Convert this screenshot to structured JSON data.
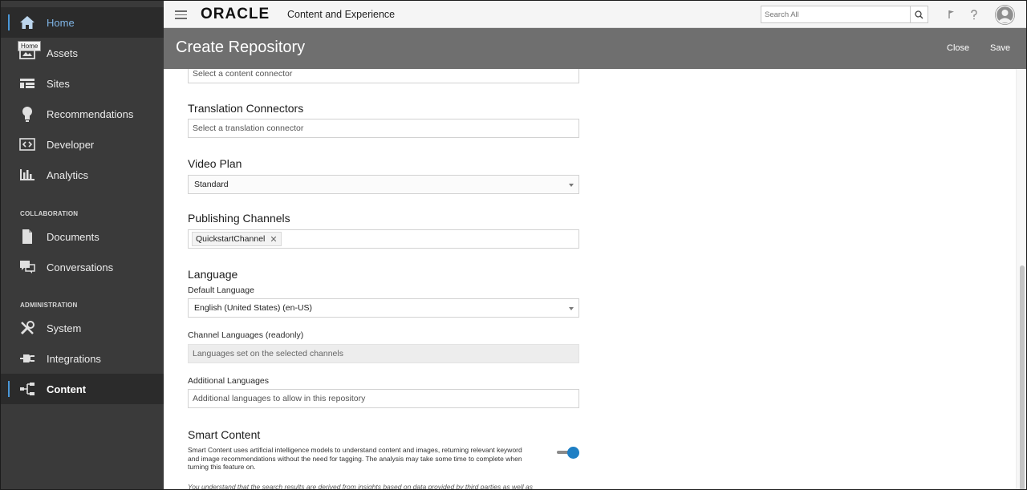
{
  "sidebar": {
    "tooltip": "Home",
    "items": [
      {
        "label": "Home",
        "icon": "home-icon"
      },
      {
        "label": "Assets",
        "icon": "assets-icon"
      },
      {
        "label": "Sites",
        "icon": "sites-icon"
      },
      {
        "label": "Recommendations",
        "icon": "lightbulb-icon"
      },
      {
        "label": "Developer",
        "icon": "code-icon"
      },
      {
        "label": "Analytics",
        "icon": "bar-chart-icon"
      },
      {
        "label": "Documents",
        "icon": "document-icon"
      },
      {
        "label": "Conversations",
        "icon": "conversations-icon"
      },
      {
        "label": "System",
        "icon": "tools-icon"
      },
      {
        "label": "Integrations",
        "icon": "plug-icon"
      },
      {
        "label": "Content",
        "icon": "content-tree-icon"
      }
    ],
    "sections": {
      "collaboration": "COLLABORATION",
      "administration": "ADMINISTRATION"
    },
    "colors": {
      "background": "#3a3a3a",
      "active_accent": "#4a97d8"
    }
  },
  "header": {
    "brand": "ORACLE",
    "product": "Content and Experience",
    "search_placeholder": "Search All"
  },
  "page": {
    "title": "Create Repository",
    "close_label": "Close",
    "save_label": "Save"
  },
  "form": {
    "content_connector_placeholder": "Select a content connector",
    "translation_connectors": {
      "title": "Translation Connectors",
      "placeholder": "Select a translation connector"
    },
    "video_plan": {
      "title": "Video Plan",
      "value": "Standard"
    },
    "publishing_channels": {
      "title": "Publishing Channels",
      "chips": [
        "QuickstartChannel"
      ],
      "remove_glyph": "✕"
    },
    "language": {
      "title": "Language",
      "default_label": "Default Language",
      "default_value": "English (United States) (en-US)",
      "channel_label": "Channel Languages (readonly)",
      "channel_placeholder": "Languages set on the selected channels",
      "additional_label": "Additional Languages",
      "additional_placeholder": "Additional languages to allow in this repository"
    },
    "smart_content": {
      "title": "Smart Content",
      "description": "Smart Content uses artificial intelligence models to understand content and images, returning relevant keyword and image recommendations without the need for tagging. The analysis may take some time to complete when turning this feature on.",
      "enabled": true,
      "toggle_color": "#1e7fc4",
      "disclaimer": "You understand that the search results are derived from insights based on data provided by third parties as well as"
    }
  }
}
